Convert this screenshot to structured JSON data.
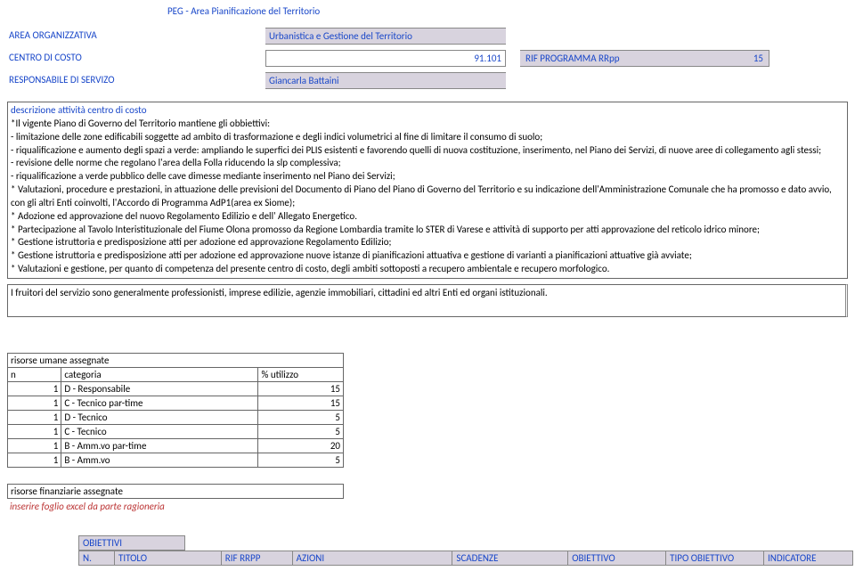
{
  "header": {
    "title": "PEG - Area Pianificazione del Territorio"
  },
  "area": {
    "label": "AREA ORGANIZZATIVA",
    "value": "Urbanistica e Gestione del Territorio"
  },
  "costo": {
    "label": "CENTRO DI COSTO",
    "value": "91.101"
  },
  "rif": {
    "label": "RIF PROGRAMMA RRpp",
    "value": "15"
  },
  "resp": {
    "label": "RESPONSABILE DI SERVIZO",
    "value": "Giancarla Battaini"
  },
  "desc": {
    "heading": "descrizione attività centro di costo",
    "lines": [
      "*Il vigente Piano di Governo del Territorio mantiene gli obbiettivi:",
      "- limitazione delle zone edificabili soggette ad ambito di  trasformazione e degli indici volumetrici al fine di limitare il consumo di suolo;",
      "- riqualificazione e aumento degli spazi a verde: ampliando  le superfici dei PLIS esistenti e favorendo quelli di nuova costituzione, inserimento, nel Piano dei Servizi, di nuove aree di collegamento agli stessi;",
      "-  revisione delle norme che regolano l'area  della Folla riducendo la slp complessiva;",
      "- riqualificazione  a verde pubblico delle cave dimesse mediante inserimento nel Piano dei Servizi;",
      "* Valutazioni, procedure e prestazioni, in attuazione delle previsioni del Documento di Piano del Piano di Governo del Territorio e su indicazione dell'Amministrazione Comunale che ha promosso e dato avvio, con gli altri Enti coinvolti, l'Accordo di Programma AdP1(area ex Siome);",
      "* Adozione ed approvazione del nuovo Regolamento Edilizio e dell' Allegato Energetico.",
      "* Partecipazione al Tavolo Interistituzionale del Fiume Olona promosso da Regione Lombardia tramite lo STER di Varese e attività di supporto per atti approvazione del reticolo idrico minore;",
      "* Gestione istruttoria e predisposizione atti per adozione ed approvazione Regolamento Edilizio;",
      "* Gestione istruttoria e predisposizione atti per adozione ed approvazione nuove istanze di  pianificazioni attuativa e gestione di varianti a pianificazioni attuative già avviate;",
      "* Valutazioni e gestione, per quanto di competenza del presente centro di costo, degli ambiti sottoposti a recupero ambientale e recupero morfologico."
    ]
  },
  "fruitori": {
    "text": "I fruitori del servizio sono generalmente professionisti, imprese edilizie, agenzie immobiliari, cittadini ed  altri Enti ed organi istituzionali."
  },
  "risorse": {
    "title": "risorse umane assegnate",
    "headers": {
      "n": "n",
      "categoria": "categoria",
      "utilizzo": "% utilizzo"
    },
    "rows": [
      {
        "n": "1",
        "cat": "D - Responsabile",
        "pct": "15"
      },
      {
        "n": "1",
        "cat": "C - Tecnico par-time",
        "pct": "15"
      },
      {
        "n": "1",
        "cat": "D - Tecnico",
        "pct": "5"
      },
      {
        "n": "1",
        "cat": "C - Tecnico",
        "pct": "5"
      },
      {
        "n": "1",
        "cat": "B - Amm.vo par-time",
        "pct": "20"
      },
      {
        "n": "1",
        "cat": "B - Amm.vo",
        "pct": "5"
      }
    ]
  },
  "finanziarie": {
    "title": "risorse finanziarie assegnate",
    "note": "inserire foglio excel da parte ragioneria"
  },
  "obiettivi": {
    "title": "OBIETTIVI",
    "cols": [
      "N.",
      "TITOLO",
      "RIF RRPP",
      "AZIONI",
      "SCADENZE",
      "OBIETTIVO",
      "TIPO OBIETTIVO",
      "INDICATORE"
    ]
  }
}
